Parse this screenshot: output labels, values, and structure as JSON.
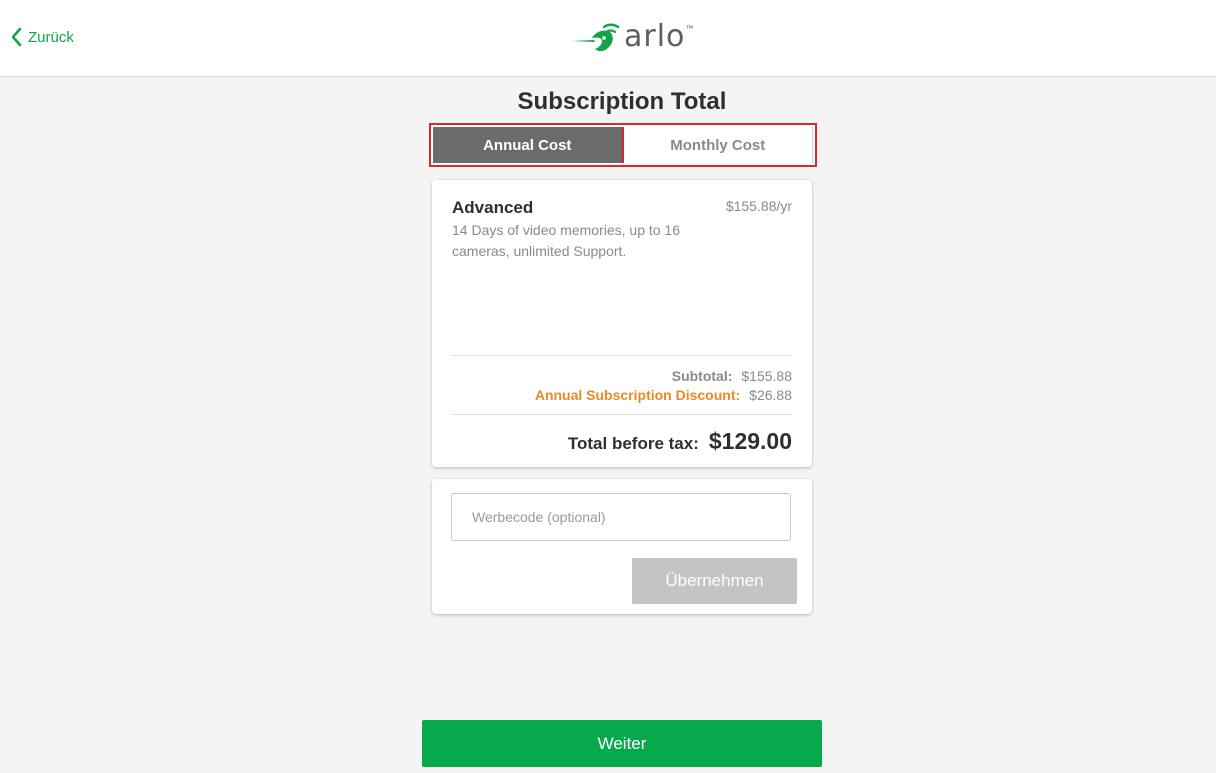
{
  "header": {
    "back_label": "Zurück",
    "logo_text": "arlo",
    "logo_tm": "™"
  },
  "page": {
    "title": "Subscription Total"
  },
  "toggle": {
    "annual_label": "Annual Cost",
    "monthly_label": "Monthly Cost",
    "selected": "annual"
  },
  "plan": {
    "name": "Advanced",
    "price": "$155.88/yr",
    "description": "14 Days of video memories, up to 16 cameras, unlimited Support."
  },
  "summary": {
    "subtotal_label": "Subtotal:",
    "subtotal_value": "$155.88",
    "discount_label": "Annual Subscription Discount:",
    "discount_value": "$26.88",
    "total_label": "Total before tax:",
    "total_value": "$129.00"
  },
  "promo": {
    "placeholder": "Werbecode (optional)",
    "value": "",
    "apply_label": "Übernehmen"
  },
  "footer": {
    "continue_label": "Weiter"
  },
  "colors": {
    "brand_green": "#08a84c",
    "back_green": "#14a24a",
    "discount_orange": "#e98a24",
    "highlight_red": "#e0262b",
    "active_toggle": "#6b6b6b",
    "disabled_button": "#c4c4c4"
  }
}
